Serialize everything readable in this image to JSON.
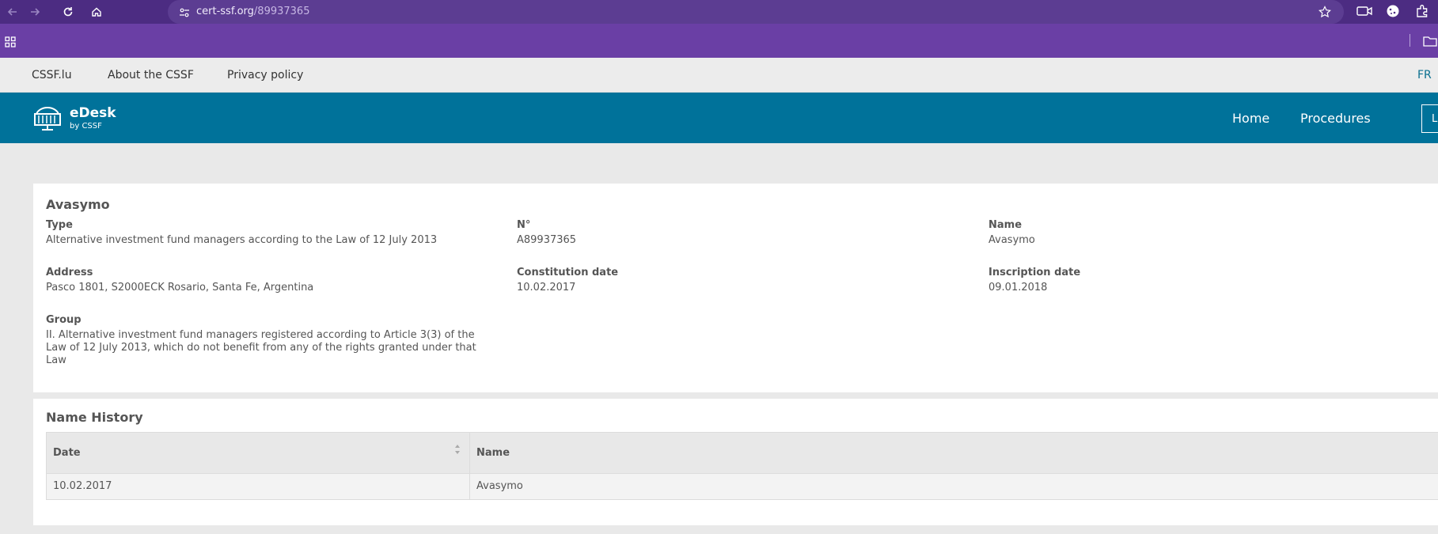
{
  "browser": {
    "url_domain": "cert-ssf.org",
    "url_path": "/89937365"
  },
  "site_links": {
    "cssf": "CSSF.lu",
    "about": "About the CSSF",
    "privacy": "Privacy policy",
    "language": "FR"
  },
  "header": {
    "brand_title": "eDesk",
    "brand_subtitle": "by CSSF",
    "nav_home": "Home",
    "nav_procedures": "Procedures",
    "login_partial": "L"
  },
  "entity": {
    "title": "Avasymo",
    "type_label": "Type",
    "type_value": "Alternative investment fund managers according to the Law of 12 July 2013",
    "number_label": "N°",
    "number_value": "A89937365",
    "name_label": "Name",
    "name_value": "Avasymo",
    "address_label": "Address",
    "address_value": "Pasco 1801, S2000ECK Rosario, Santa Fe, Argentina",
    "constitution_label": "Constitution date",
    "constitution_value": "10.02.2017",
    "inscription_label": "Inscription date",
    "inscription_value": "09.01.2018",
    "group_label": "Group",
    "group_line1": "II. Alternative investment fund managers registered according to Article 3(3) of the",
    "group_line2": "Law of 12 July 2013, which do not benefit from any of the rights granted under that",
    "group_line3": "Law"
  },
  "name_history": {
    "title": "Name History",
    "col_date": "Date",
    "col_name": "Name",
    "rows": [
      {
        "date": "10.02.2017",
        "name": "Avasymo"
      }
    ]
  },
  "colors": {
    "chrome_top": "#4c2c82",
    "bookmarks_bar": "#6a3fa5",
    "header_blue": "#00729a"
  }
}
